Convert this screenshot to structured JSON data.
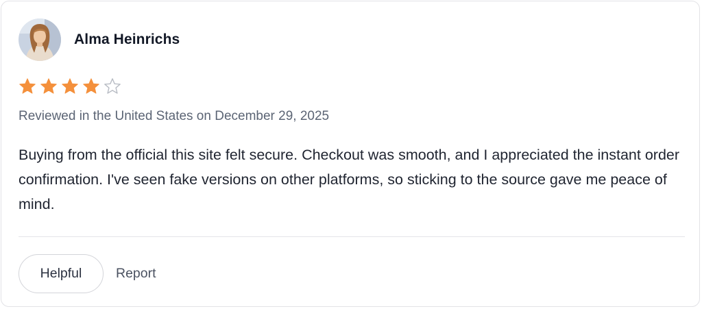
{
  "review": {
    "reviewer_name": "Alma Heinrichs",
    "avatar_icon": "user-photo-avatar",
    "rating": 4,
    "rating_max": 5,
    "star_color": "#f4903c",
    "empty_star_color": "#b8bcc4",
    "date_text": "Reviewed in the United States on December 29, 2025",
    "body": "Buying from the official this site felt secure. Checkout was smooth, and I appreciated the instant order confirmation. I've seen fake versions on other platforms, so sticking to the source gave me peace of mind."
  },
  "actions": {
    "helpful_label": "Helpful",
    "report_label": "Report"
  }
}
